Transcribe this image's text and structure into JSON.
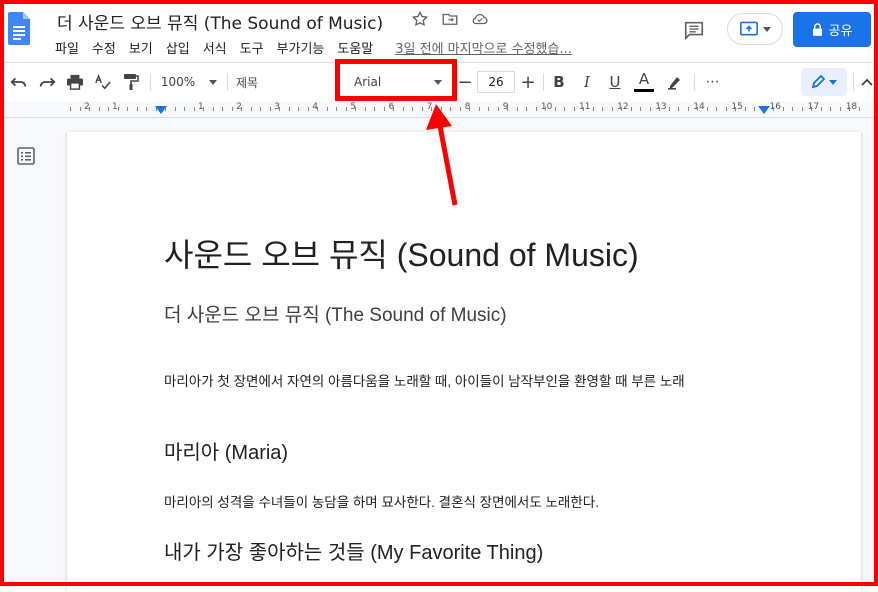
{
  "title_bar": {
    "doc_title": "더 사운드 오브 뮤직 (The Sound of Music)",
    "last_edit": "3일 전에 마지막으로 수정했습..."
  },
  "menus": [
    "파일",
    "수정",
    "보기",
    "삽입",
    "서식",
    "도구",
    "부가기능",
    "도움말"
  ],
  "share_label": "공유",
  "toolbar": {
    "zoom": "100%",
    "style": "제목",
    "font": "Arial",
    "font_size": "26",
    "bold": "B",
    "italic": "I",
    "underline": "U",
    "text_color": "A",
    "more": "⋯"
  },
  "ruler_labels": [
    "2",
    "1",
    "1",
    "2",
    "3",
    "4",
    "5",
    "6",
    "7",
    "8",
    "9",
    "10",
    "11",
    "12",
    "13",
    "14",
    "15",
    "16",
    "17",
    "18"
  ],
  "document": {
    "title": "사운드 오브 뮤직 (Sound of Music)",
    "subtitle": "더 사운드 오브 뮤직 (The Sound of Music)",
    "para1": "마리아가 첫 장면에서 자연의 아름다움을 노래할 때, 아이들이 남작부인을 환영할 때 부른 노래",
    "heading_maria": "마리아 (Maria)",
    "para2": "마리아의 성격을 수녀들이 농담을 하며 묘사한다. 결혼식 장면에서도 노래한다.",
    "heading_favorite": "내가 가장 좋아하는 것들 (My Favorite Thing)"
  },
  "colors": {
    "accent": "#1a73e8",
    "annotation": "#ff0000",
    "text_color_underline": "#000000"
  }
}
